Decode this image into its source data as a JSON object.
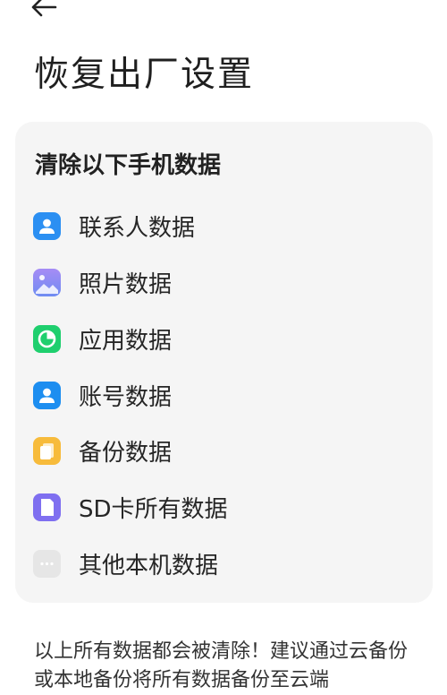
{
  "header": {
    "back_icon": "arrow-left-icon",
    "title": "恢复出厂设置"
  },
  "card": {
    "title": "清除以下手机数据",
    "items": [
      {
        "label": "联系人数据",
        "icon": "contacts-icon",
        "color": "#2b8ff2"
      },
      {
        "label": "照片数据",
        "icon": "photos-icon",
        "color": "#8c7cf0"
      },
      {
        "label": "应用数据",
        "icon": "apps-icon",
        "color": "#1fcf6e"
      },
      {
        "label": "账号数据",
        "icon": "account-icon",
        "color": "#1d8ef0"
      },
      {
        "label": "备份数据",
        "icon": "backup-icon",
        "color": "#f7bb3b"
      },
      {
        "label": "SD卡所有数据",
        "icon": "sd-card-icon",
        "color": "#7f6ff0"
      },
      {
        "label": "其他本机数据",
        "icon": "more-icon",
        "color": "#e6e6e6"
      }
    ]
  },
  "footer": {
    "text": "以上所有数据都会被清除！建议通过云备份或本地备份将所有数据备份至云端"
  }
}
